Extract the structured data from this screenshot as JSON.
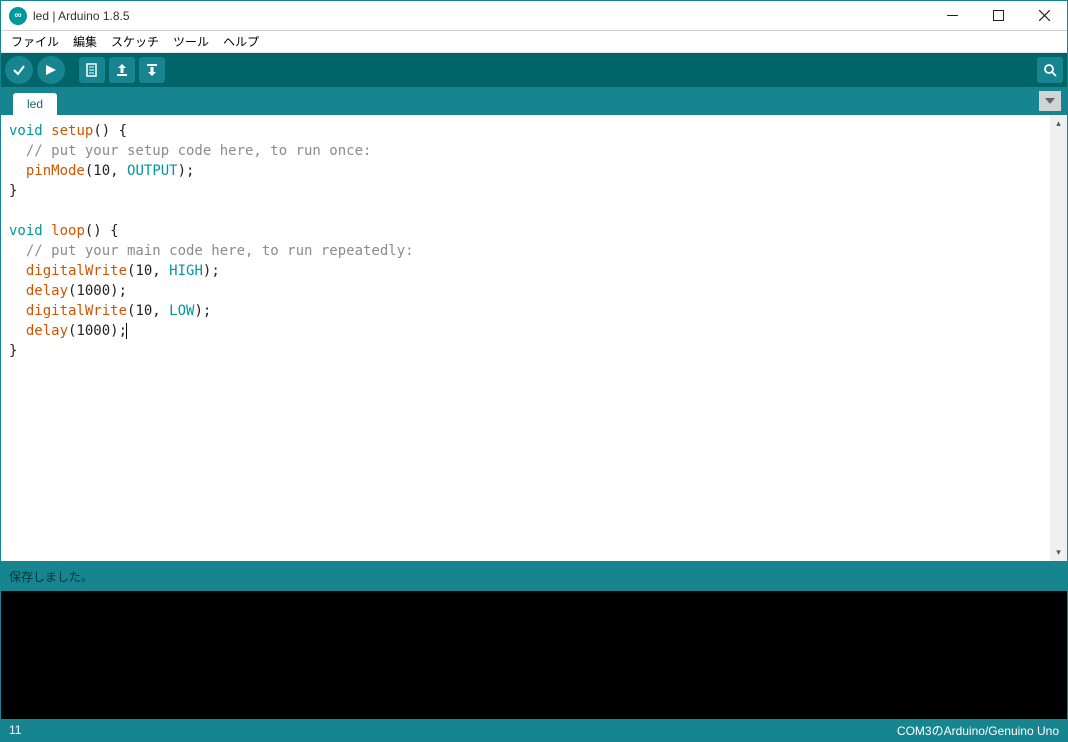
{
  "window": {
    "title": "led | Arduino 1.8.5"
  },
  "menu": {
    "file": "ファイル",
    "edit": "編集",
    "sketch": "スケッチ",
    "tools": "ツール",
    "help": "ヘルプ"
  },
  "tabs": {
    "active": "led"
  },
  "code": {
    "l1_kw": "void",
    "l1_fn": "setup",
    "l1_rest": "() {",
    "l2_cm": "  // put your setup code here, to run once:",
    "l3_sp": "  ",
    "l3_fn": "pinMode",
    "l3_a": "(10, ",
    "l3_c": "OUTPUT",
    "l3_b": ");",
    "l4": "}",
    "l5": "",
    "l6_kw": "void",
    "l6_fn": "loop",
    "l6_rest": "() {",
    "l7_cm": "  // put your main code here, to run repeatedly:",
    "l8_sp": "  ",
    "l8_fn": "digitalWrite",
    "l8_a": "(10, ",
    "l8_c": "HIGH",
    "l8_b": ");",
    "l9_sp": "  ",
    "l9_fn": "delay",
    "l9_a": "(1000);",
    "l10_sp": "  ",
    "l10_fn": "digitalWrite",
    "l10_a": "(10, ",
    "l10_c": "LOW",
    "l10_b": ");",
    "l11_sp": "  ",
    "l11_fn": "delay",
    "l11_a": "(1000);",
    "l12": "}"
  },
  "status": {
    "message": "保存しました。"
  },
  "footer": {
    "line": "11",
    "board": "COM3のArduino/Genuino Uno"
  }
}
